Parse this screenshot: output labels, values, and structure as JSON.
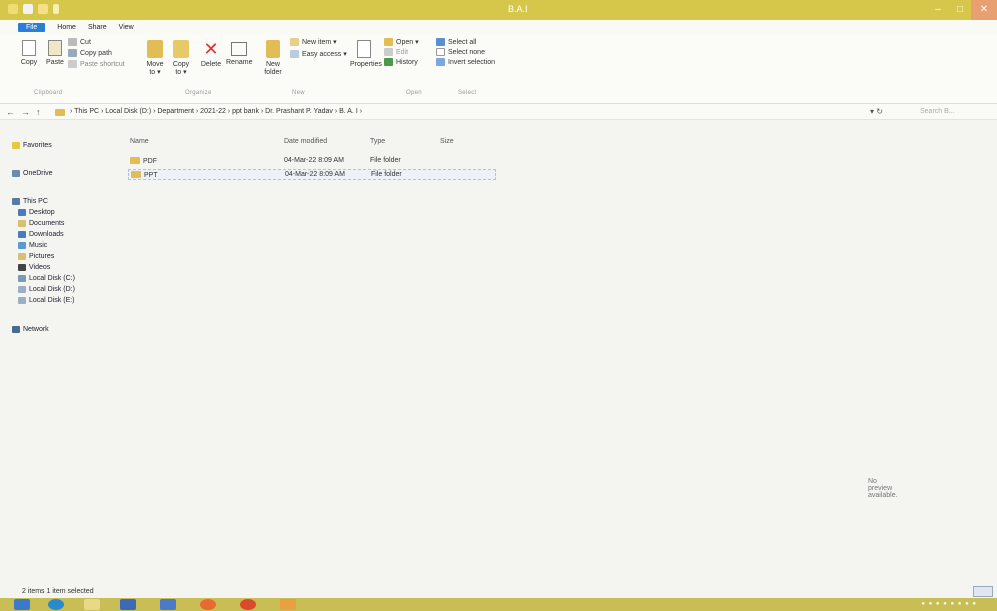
{
  "window": {
    "title": "B.A.I",
    "minimize": "–",
    "maximize": "□",
    "close": "✕"
  },
  "ribbon_tabs": [
    "File",
    "Home",
    "Share",
    "View"
  ],
  "ribbon": {
    "clipboard": {
      "copy": "Copy",
      "paste": "Paste",
      "cut": "Cut",
      "copy_path": "Copy path",
      "paste_shortcut": "Paste shortcut",
      "label": "Clipboard"
    },
    "organize": {
      "move_to": "Move to ▾",
      "copy_to": "Copy to ▾",
      "delete": "Delete",
      "rename": "Rename",
      "label": "Organize"
    },
    "new": {
      "new_folder": "New folder",
      "new_item": "New item ▾",
      "easy_access": "Easy access ▾",
      "label": "New"
    },
    "open": {
      "properties": "Properties",
      "open": "Open ▾",
      "edit": "Edit",
      "history": "History",
      "label": "Open"
    },
    "select": {
      "select_all": "Select all",
      "select_none": "Select none",
      "invert": "Invert selection",
      "label": "Select"
    }
  },
  "address": {
    "back": "←",
    "forward": "→",
    "up": "↑",
    "path": "› This PC › Local Disk (D:) › Department › 2021-22 › ppt bank › Dr. Prashant P. Yadav › B. A. I ›",
    "search_placeholder": "Search B...",
    "refresh": "▾ ↻"
  },
  "sidebar": {
    "favorites": "Favorites",
    "onedrive": "OneDrive",
    "this_pc": "This PC",
    "items": [
      "Desktop",
      "Documents",
      "Downloads",
      "Music",
      "Pictures",
      "Videos",
      "Local Disk (C:)",
      "Local Disk (D:)",
      "Local Disk (E:)"
    ],
    "network": "Network"
  },
  "columns": {
    "name": "Name",
    "date": "Date modified",
    "type": "Type",
    "size": "Size"
  },
  "files": [
    {
      "name": "PDF",
      "date": "04-Mar-22 8:09 AM",
      "type": "File folder",
      "size": ""
    },
    {
      "name": "PPT",
      "date": "04-Mar-22 8:09 AM",
      "type": "File folder",
      "size": ""
    }
  ],
  "preview_text": "No preview available.",
  "status": "2 items   1 item selected",
  "colors": {
    "titlebar": "#d6c64a",
    "file_tab": "#2a7ed8",
    "folder": "#e2bd55",
    "taskbar": "#c9bd55"
  }
}
